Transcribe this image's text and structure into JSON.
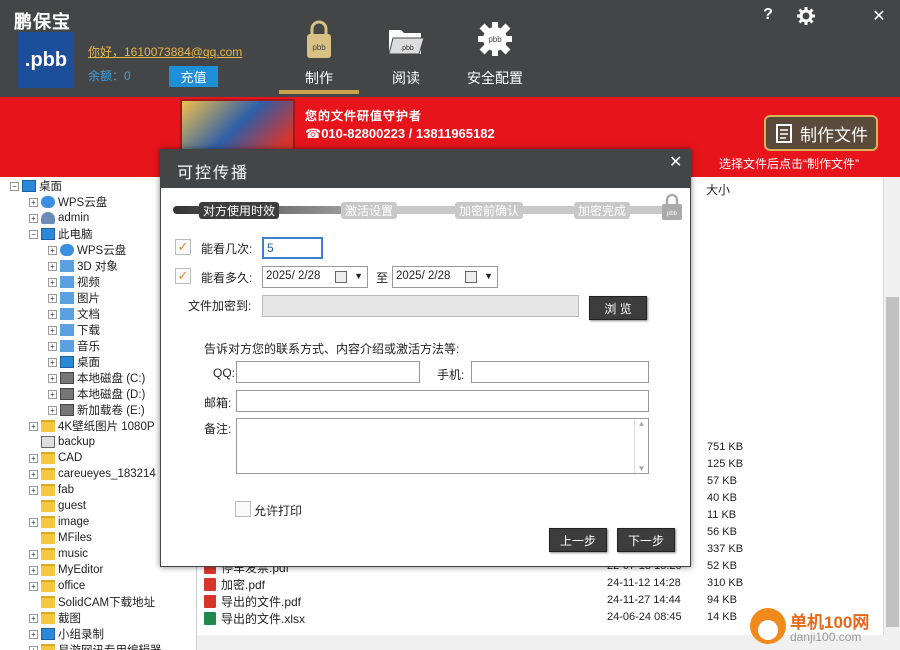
{
  "app": {
    "title": "鹏保宝",
    "logo_text": ".pbb"
  },
  "user": {
    "greeting": "你好，1610073884@qq.com",
    "balance": "余额：0",
    "recharge_label": "充值"
  },
  "nav": {
    "tabs": [
      {
        "label": "制作",
        "icon": "lock-pbb-icon"
      },
      {
        "label": "阅读",
        "icon": "folder-open-icon"
      },
      {
        "label": "安全配置",
        "icon": "gear-pbb-icon"
      }
    ]
  },
  "window_controls": {
    "help": "?",
    "settings": "gear-icon",
    "close": "✕"
  },
  "banner": {
    "slogan": "您的文件研值守护者",
    "phone": "☎010-82800223 / 13811965182",
    "make_label": "制作文件",
    "hint": "选择文件后点击“制作文件”"
  },
  "tree": {
    "items": [
      {
        "label": "桌面",
        "icon": "desktop-icon",
        "exp": "−"
      },
      {
        "label": "WPS云盘",
        "icon": "cloud-icon",
        "exp": "+"
      },
      {
        "label": "admin",
        "icon": "user-icon",
        "exp": "+"
      },
      {
        "label": "此电脑",
        "icon": "computer-icon",
        "exp": "−"
      },
      {
        "label": "WPS云盘",
        "icon": "cloud-icon",
        "exp": "+"
      },
      {
        "label": "3D 对象",
        "icon": "3d-objects-icon",
        "exp": "+"
      },
      {
        "label": "视频",
        "icon": "video-icon",
        "exp": "+"
      },
      {
        "label": "图片",
        "icon": "pictures-icon",
        "exp": "+"
      },
      {
        "label": "文档",
        "icon": "documents-icon",
        "exp": "+"
      },
      {
        "label": "下载",
        "icon": "download-icon",
        "exp": "+"
      },
      {
        "label": "音乐",
        "icon": "music-icon",
        "exp": "+"
      },
      {
        "label": "桌面",
        "icon": "desktop-icon",
        "exp": "+"
      },
      {
        "label": "本地磁盘 (C:)",
        "icon": "drive-icon",
        "exp": "+"
      },
      {
        "label": "本地磁盘 (D:)",
        "icon": "drive-icon",
        "exp": "+"
      },
      {
        "label": "新加载卷 (E:)",
        "icon": "drive-icon",
        "exp": "+"
      },
      {
        "label": "4K壁纸图片 1080P",
        "icon": "folder-icon",
        "exp": "+"
      },
      {
        "label": "backup",
        "icon": "printer-icon",
        "exp": ""
      },
      {
        "label": "CAD",
        "icon": "folder-icon",
        "exp": "+"
      },
      {
        "label": "careueyes_183214",
        "icon": "folder-icon",
        "exp": "+"
      },
      {
        "label": "fab",
        "icon": "folder-icon",
        "exp": "+"
      },
      {
        "label": "guest",
        "icon": "folder-icon",
        "exp": ""
      },
      {
        "label": "image",
        "icon": "folder-icon",
        "exp": "+"
      },
      {
        "label": "MFiles",
        "icon": "folder-icon",
        "exp": ""
      },
      {
        "label": "music",
        "icon": "folder-icon",
        "exp": "+"
      },
      {
        "label": "MyEditor",
        "icon": "folder-icon",
        "exp": "+"
      },
      {
        "label": "office",
        "icon": "folder-icon",
        "exp": "+"
      },
      {
        "label": "SolidCAM下载地址",
        "icon": "folder-icon",
        "exp": ""
      },
      {
        "label": "截图",
        "icon": "folder-icon",
        "exp": "+"
      },
      {
        "label": "小组录制",
        "icon": "computer-icon",
        "exp": "+"
      },
      {
        "label": "易游网讯专用编辑器",
        "icon": "folder-icon",
        "exp": "+"
      }
    ]
  },
  "file_list": {
    "size_header": "大小",
    "sizes": [
      "751 KB",
      "125 KB",
      "57 KB",
      "40 KB",
      "11 KB",
      "56 KB",
      "337 KB",
      "52 KB",
      "310 KB",
      "94 KB",
      "14 KB"
    ],
    "files": [
      {
        "name": "停车发票.pdf",
        "date": "22-07-13 15:20",
        "type": "pdf"
      },
      {
        "name": "加密.pdf",
        "date": "24-11-12 14:28",
        "type": "pdf"
      },
      {
        "name": "导出的文件.pdf",
        "date": "24-11-27 14:44",
        "type": "pdf"
      },
      {
        "name": "导出的文件.xlsx",
        "date": "24-06-24 08:45",
        "type": "xls"
      }
    ]
  },
  "dialog": {
    "title": "可控传播",
    "close": "✕",
    "steps": [
      "对方使用时效",
      "激活设置",
      "加密前确认",
      "加密完成"
    ],
    "times_label": "能看几次:",
    "times_value": "5",
    "duration_label": "能看多久:",
    "date_from": "2025/ 2/28",
    "date_to_label": "至",
    "date_to": "2025/ 2/28",
    "encrypt_to_label": "文件加密到:",
    "browse_label": "浏 览",
    "contact_hint": "告诉对方您的联系方式、内容介绍或激活方法等:",
    "qq_label": "QQ:",
    "phone_label": "手机:",
    "email_label": "邮箱:",
    "note_label": "备注:",
    "allow_print_label": "允许打印",
    "prev_label": "上一步",
    "next_label": "下一步"
  },
  "watermark": {
    "text1": "单机100网",
    "text2": "danji100.com"
  }
}
